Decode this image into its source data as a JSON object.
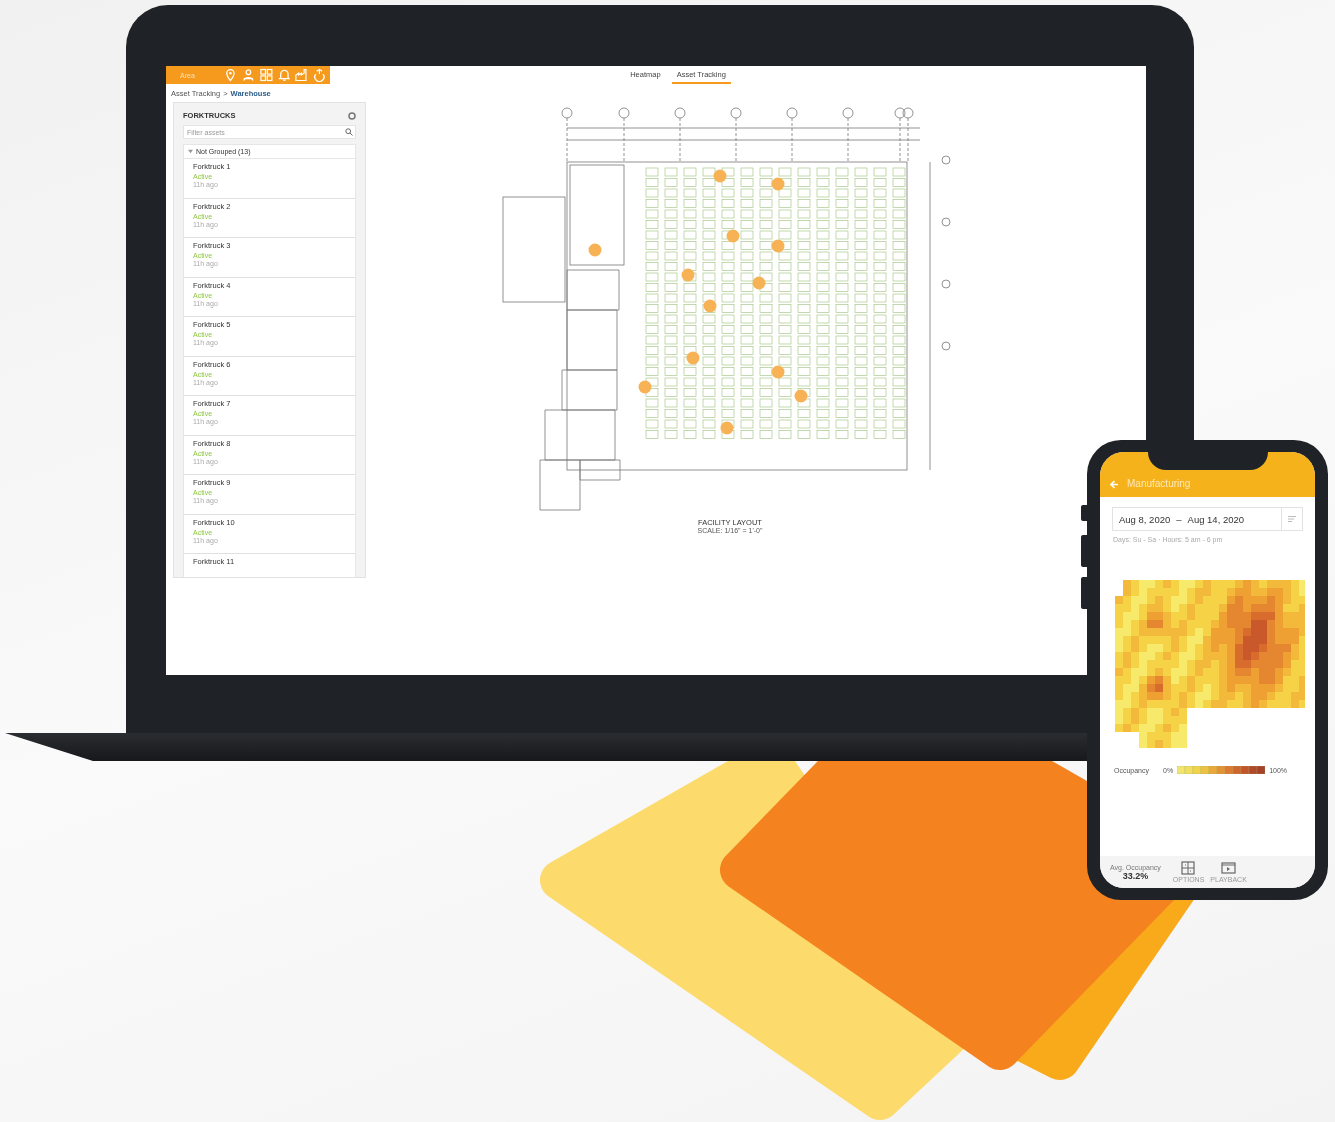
{
  "laptop": {
    "toolbar": {
      "area_label": "Area"
    },
    "tabs": [
      {
        "label": "Heatmap",
        "selected": false
      },
      {
        "label": "Asset Tracking",
        "selected": true
      }
    ],
    "breadcrumb": {
      "parent": "Asset Tracking",
      "separator": ">",
      "current": "Warehouse"
    },
    "asset_panel": {
      "title": "FORKTRUCKS",
      "filter_placeholder": "Filter assets",
      "group": {
        "label": "Not Grouped (13)",
        "expanded": true
      },
      "items": [
        {
          "name": "Forktruck 1",
          "status": "Active",
          "time": "11h ago"
        },
        {
          "name": "Forktruck 2",
          "status": "Active",
          "time": "11h ago"
        },
        {
          "name": "Forktruck 3",
          "status": "Active",
          "time": "11h ago"
        },
        {
          "name": "Forktruck 4",
          "status": "Active",
          "time": "11h ago"
        },
        {
          "name": "Forktruck 5",
          "status": "Active",
          "time": "11h ago"
        },
        {
          "name": "Forktruck 6",
          "status": "Active",
          "time": "11h ago"
        },
        {
          "name": "Forktruck 7",
          "status": "Active",
          "time": "11h ago"
        },
        {
          "name": "Forktruck 8",
          "status": "Active",
          "time": "11h ago"
        },
        {
          "name": "Forktruck 9",
          "status": "Active",
          "time": "11h ago"
        },
        {
          "name": "Forktruck 10",
          "status": "Active",
          "time": "11h ago"
        },
        {
          "name": "Forktruck 11"
        }
      ]
    },
    "floor_plan": {
      "title": "FACILITY LAYOUT",
      "scale": "SCALE: 1/16\" = 1'-0\""
    }
  },
  "phone": {
    "header": {
      "title": "Manufacturing"
    },
    "date_range": {
      "from": "Aug 8, 2020",
      "separator": "–",
      "to": "Aug 14, 2020"
    },
    "schedule": "Days: Su - Sa · Hours: 5 am - 6 pm",
    "legend": {
      "label": "Occupancy",
      "min": "0%",
      "max": "100%"
    },
    "footer": {
      "avg_label": "Avg. Occupancy",
      "avg_value": "33.2%",
      "buttons": [
        {
          "kind": "options",
          "label": "OPTIONS"
        },
        {
          "kind": "playback",
          "label": "PLAYBACK"
        }
      ]
    }
  }
}
